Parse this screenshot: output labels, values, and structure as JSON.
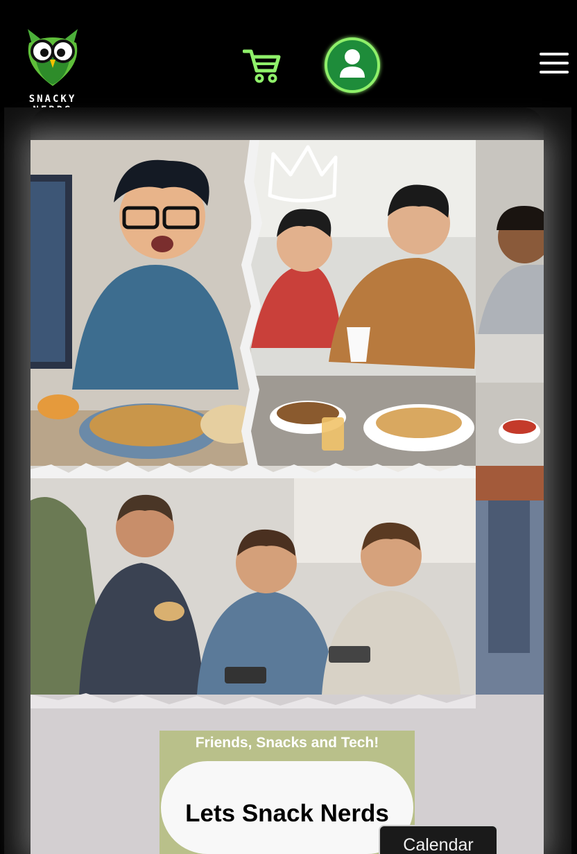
{
  "brand": {
    "name": "SNACKY NERDS"
  },
  "hero": {
    "tagline": "Friends, Snacks and Tech!",
    "cta_label": "Lets Snack Nerds"
  },
  "footer_tab": {
    "label": "Calendar"
  },
  "colors": {
    "accent_green": "#8ff06a",
    "account_fill": "#1e8c3a",
    "tagline_bg": "#b9c08a"
  }
}
